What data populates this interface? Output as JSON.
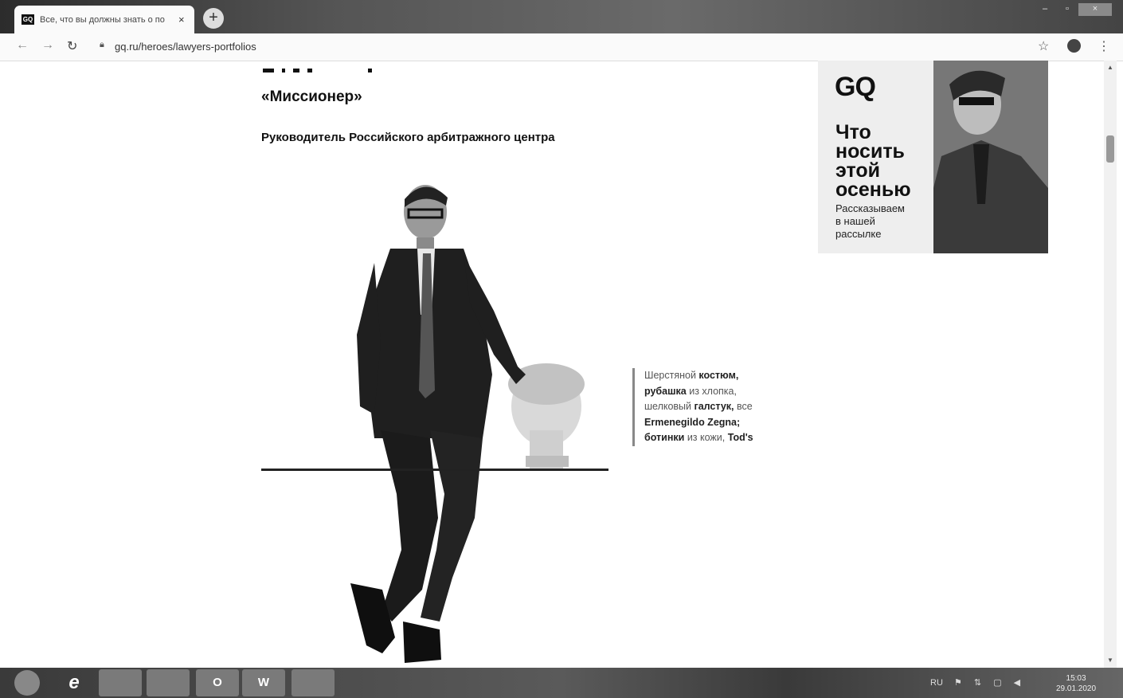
{
  "browser": {
    "tab_title": "Все, что вы должны знать о по",
    "tab_favicon": "GQ",
    "tab_close": "×",
    "new_tab": "+",
    "url": "gq.ru/heroes/lawyers-portfolios",
    "window_buttons": [
      "–",
      "▫",
      "×"
    ]
  },
  "article": {
    "title": "«Миссионер»",
    "subtitle": "Руководитель Российского арбитражного центра",
    "caption": {
      "p1": "Шерстяной ",
      "b1": "костюм,",
      "b2": "рубашка",
      "p2": " из хлопка,",
      "p3": "шелковый ",
      "b3": "галстук,",
      "p4": "все ",
      "b4": "Ermenegildo Zegna; ботинки",
      "p5": "из кожи, ",
      "b5": "Tod's"
    }
  },
  "ad": {
    "logo": "GQ",
    "headline": [
      "Что",
      "носить",
      "этой",
      "осенью"
    ],
    "text": [
      "Рассказываем",
      "в нашей",
      "рассылке"
    ]
  },
  "taskbar": {
    "apps": [
      "e",
      "",
      "",
      "O",
      "W",
      ""
    ],
    "lang": "RU",
    "time": "15:03",
    "date": "29.01.2020"
  },
  "icons": {
    "back": "back-arrow-icon",
    "forward": "forward-arrow-icon",
    "reload": "reload-icon",
    "lock": "lock-icon",
    "bookmark": "star-icon",
    "account": "account-icon",
    "menu": "kebab-menu-icon"
  }
}
